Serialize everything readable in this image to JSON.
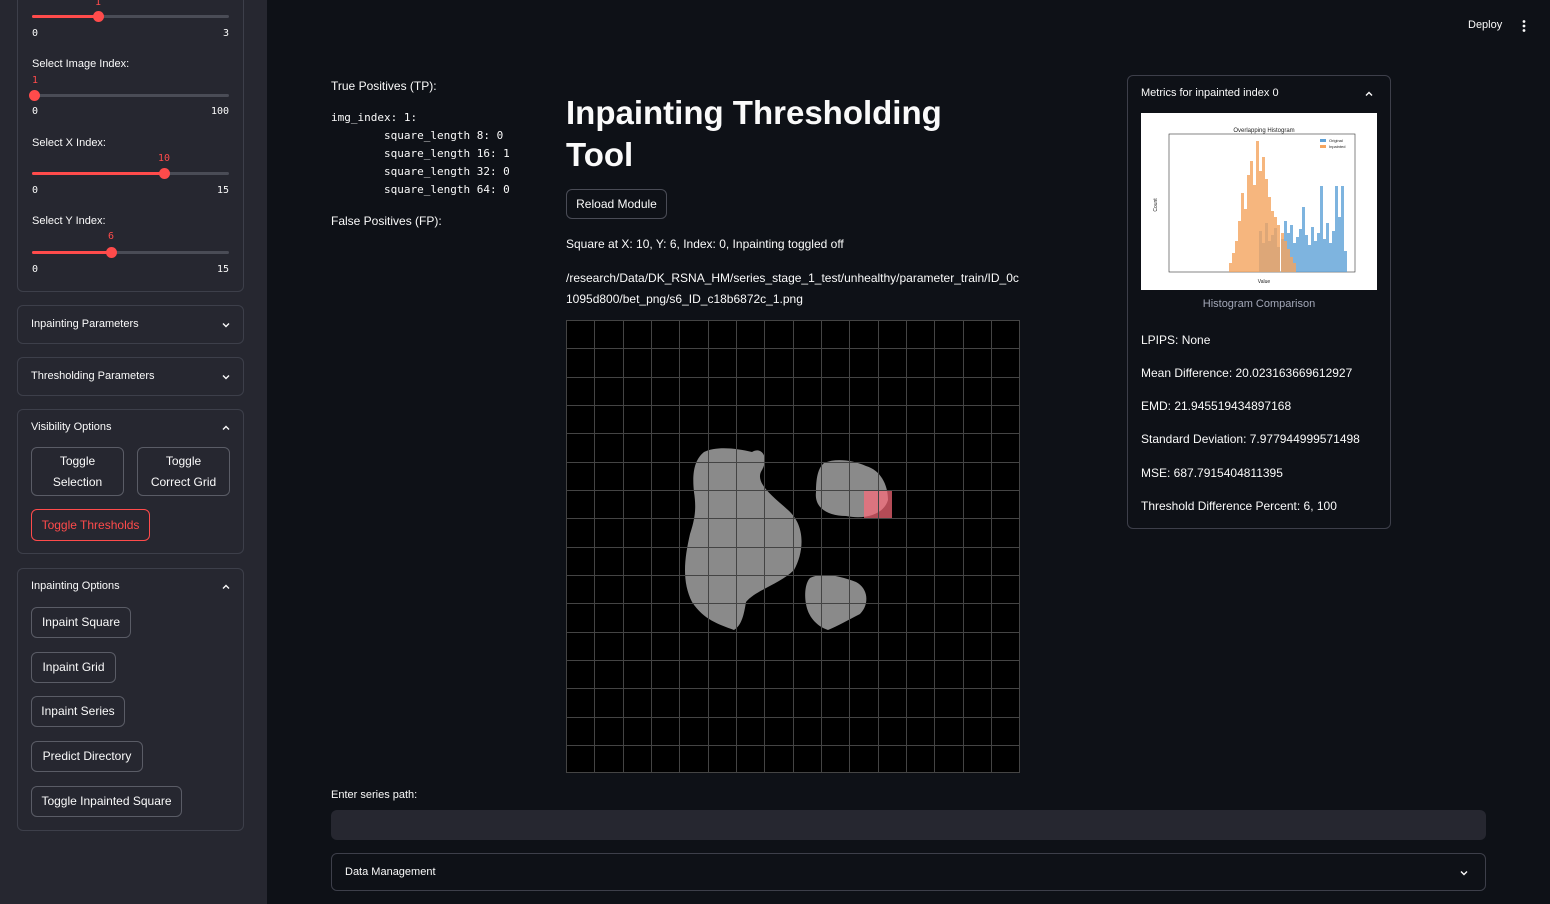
{
  "sidebar": {
    "slider_top": {
      "value": "1",
      "min": "0",
      "max": "3",
      "fraction": 0.333
    },
    "image_slider": {
      "label": "Select Image Index:",
      "value": "1",
      "min": "0",
      "max": "100",
      "fraction": 0.01
    },
    "x_slider": {
      "label": "Select X Index:",
      "value": "10",
      "min": "0",
      "max": "15",
      "fraction": 0.667
    },
    "y_slider": {
      "label": "Select Y Index:",
      "value": "6",
      "min": "0",
      "max": "15",
      "fraction": 0.4
    },
    "inpainting_parameters": "Inpainting Parameters",
    "thresholding_parameters": "Thresholding Parameters",
    "visibility_options": {
      "title": "Visibility Options",
      "toggle_selection": "Toggle Selection",
      "toggle_correct_grid": "Toggle Correct Grid",
      "toggle_thresholds": "Toggle Thresholds"
    },
    "inpainting_options": {
      "title": "Inpainting Options",
      "inpaint_square": "Inpaint Square",
      "inpaint_grid": "Inpaint Grid",
      "inpaint_series": "Inpaint Series",
      "predict_directory": "Predict Directory",
      "toggle_inpainted_square": "Toggle Inpainted Square"
    }
  },
  "header": {
    "deploy": "Deploy"
  },
  "results": {
    "tp_label": "True Positives (TP):",
    "tp_code": "img_index: 1:\n        square_length 8: 0\n        square_length 16: 1\n        square_length 32: 0\n        square_length 64: 0",
    "fp_label": "False Positives (FP):"
  },
  "main": {
    "title": "Inpainting Thresholding Tool",
    "reload_button": "Reload Module",
    "square_info": "Square at X: 10, Y: 6, Index: 0, Inpainting toggled off",
    "image_path": "/research/Data/DK_RSNA_HM/series_stage_1_test/unhealthy/parameter_train/ID_0c1095d800/bet_png/s6_ID_c18b6872c_1.png",
    "series_label": "Enter series path:",
    "series_value": "",
    "data_management": "Data Management"
  },
  "metrics": {
    "title": "Metrics for inpainted index 0",
    "histogram_caption": "Histogram Comparison",
    "histogram_title": "Overlapping Histogram",
    "histogram_xlabel": "Value",
    "histogram_ylabel": "Count",
    "legend_original": "Original",
    "legend_inpainted": "Inpainted",
    "lpips": "LPIPS: None",
    "mean_difference": "Mean Difference: 20.023163669612927",
    "emd": "EMD: 21.945519434897168",
    "std_dev": "Standard Deviation: 7.977944999571498",
    "mse": "MSE: 687.7915404811395",
    "threshold_diff": "Threshold Difference Percent: 6, 100"
  },
  "colors": {
    "accent": "#ff4b4b",
    "background": "#0e1117",
    "sidebar": "#262730"
  }
}
